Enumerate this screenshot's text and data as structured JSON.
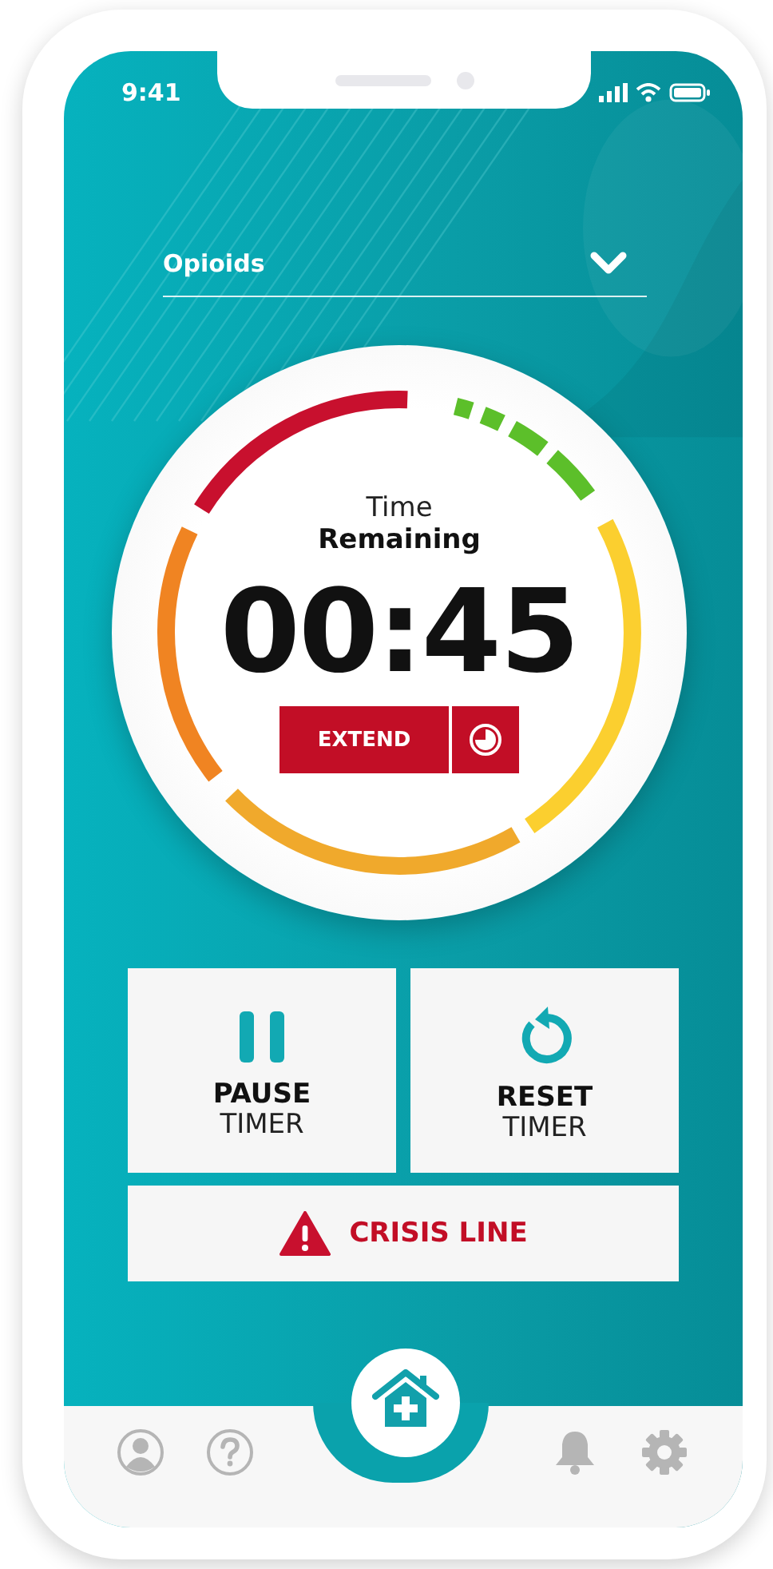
{
  "status_bar": {
    "time": "9:41"
  },
  "dropdown": {
    "value": "Opioids"
  },
  "timer": {
    "label_top": "Time",
    "label_bottom": "Remaining",
    "time": "00:45",
    "extend_button": "EXTEND"
  },
  "actions": [
    {
      "kind": "pause",
      "title": "PAUSE",
      "subtitle": "TIMER"
    },
    {
      "kind": "reset",
      "title": "RESET",
      "subtitle": "TIMER"
    }
  ],
  "crisis_button": {
    "label": "CRISIS LINE"
  },
  "bottom_nav": [
    {
      "kind": "profile"
    },
    {
      "kind": "help"
    },
    {
      "kind": "home"
    },
    {
      "kind": "notifications"
    },
    {
      "kind": "settings"
    }
  ]
}
